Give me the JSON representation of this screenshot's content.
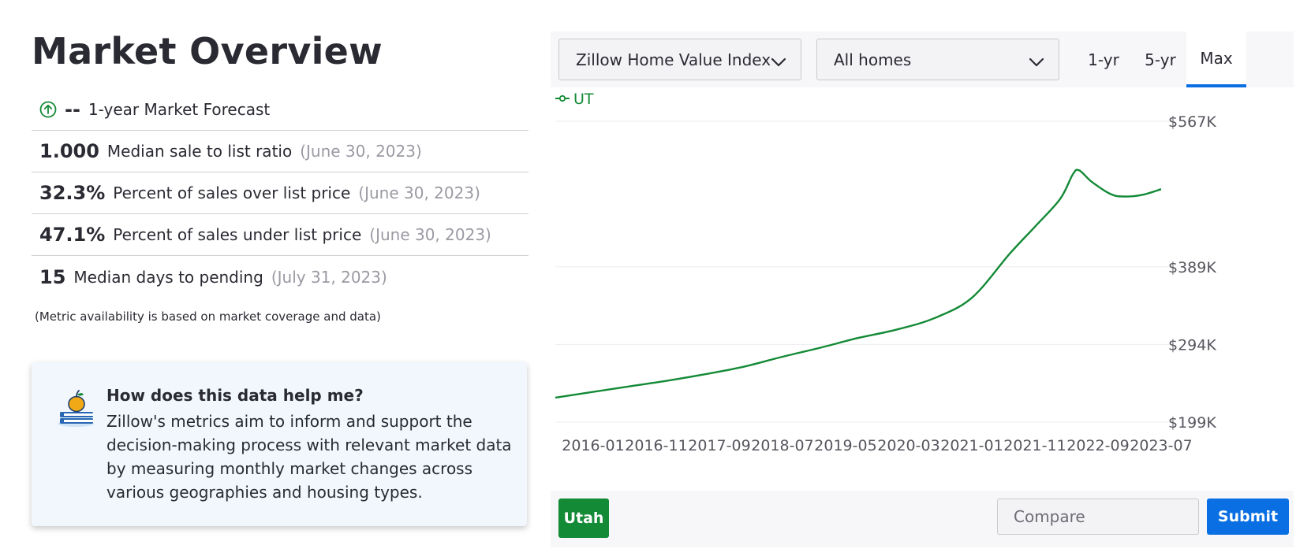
{
  "page": {
    "title": "Market Overview"
  },
  "metrics": [
    {
      "value": "--",
      "label": "1-year Market Forecast",
      "date": "",
      "icon": "arrow-up-circle-icon"
    },
    {
      "value": "1.000",
      "label": "Median sale to list ratio",
      "date": "(June 30, 2023)"
    },
    {
      "value": "32.3%",
      "label": "Percent of sales over list price",
      "date": "(June 30, 2023)"
    },
    {
      "value": "47.1%",
      "label": "Percent of sales under list price",
      "date": "(June 30, 2023)"
    },
    {
      "value": "15",
      "label": "Median days to pending",
      "date": "(July 31, 2023)"
    }
  ],
  "note": "(Metric availability is based on market coverage and data)",
  "help": {
    "title": "How does this data help me?",
    "body": "Zillow's metrics aim to inform and support the decision-making process with relevant market data by measuring monthly market changes across various geographies and housing types.",
    "icon": "apple-books-icon"
  },
  "controls": {
    "metric_select": "Zillow Home Value Index",
    "home_type_select": "All homes",
    "ranges": [
      "1-yr",
      "5-yr",
      "Max"
    ],
    "active_range": "Max"
  },
  "bottom": {
    "region_button": "Utah",
    "compare_placeholder": "Compare",
    "submit_label": "Submit"
  },
  "colors": {
    "accent": "#0a6fe3",
    "series": "#138a36",
    "text": "#2a2a33",
    "muted": "#9a9aa3"
  },
  "chart_data": {
    "type": "line",
    "title": "",
    "xlabel": "",
    "ylabel": "",
    "y_ticks": [
      {
        "value": 199,
        "label": "$199K"
      },
      {
        "value": 294,
        "label": "$294K"
      },
      {
        "value": 389,
        "label": "$389K"
      },
      {
        "value": 567,
        "label": "$567K"
      }
    ],
    "ylim": [
      199,
      567
    ],
    "x_ticks": [
      "2016-01",
      "2016-11",
      "2017-09",
      "2018-07",
      "2019-05",
      "2020-03",
      "2021-01",
      "2021-11",
      "2022-09",
      "2023-07"
    ],
    "xlim": [
      "2015-07",
      "2023-07"
    ],
    "grid": true,
    "legend": {
      "position": "top-left"
    },
    "series": [
      {
        "name": "UT",
        "color": "#138a36",
        "points": [
          [
            "2015-07",
            229
          ],
          [
            "2016-01",
            236
          ],
          [
            "2016-07",
            243
          ],
          [
            "2017-01",
            250
          ],
          [
            "2017-07",
            258
          ],
          [
            "2018-01",
            267
          ],
          [
            "2018-07",
            279
          ],
          [
            "2019-01",
            290
          ],
          [
            "2019-07",
            302
          ],
          [
            "2020-01",
            312
          ],
          [
            "2020-07",
            326
          ],
          [
            "2021-01",
            351
          ],
          [
            "2021-07",
            405
          ],
          [
            "2021-11",
            438
          ],
          [
            "2022-03",
            472
          ],
          [
            "2022-05",
            502
          ],
          [
            "2022-06",
            507
          ],
          [
            "2022-08",
            493
          ],
          [
            "2022-11",
            478
          ],
          [
            "2023-01",
            475
          ],
          [
            "2023-04",
            477
          ],
          [
            "2023-07",
            484
          ]
        ]
      }
    ]
  }
}
